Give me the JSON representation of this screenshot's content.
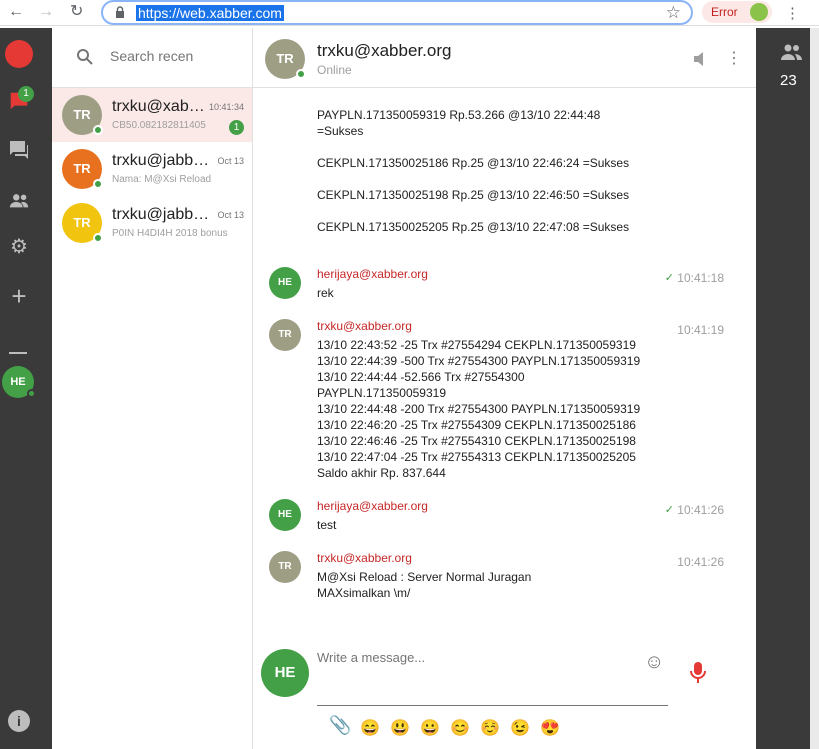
{
  "browser": {
    "url": "https://web.xabber.com",
    "error_label": "Error"
  },
  "rail": {
    "unread_badge": "1",
    "user_avatar": "HE"
  },
  "contacts": {
    "search_placeholder": "Search recen",
    "items": [
      {
        "initials": "TR",
        "name": "trxku@xabber.org",
        "time": "10:41:34",
        "preview": "CB50.082182811405",
        "count": "1",
        "color": "#9e9e85"
      },
      {
        "initials": "TR",
        "name": "trxku@jabbim.com",
        "time": "Oct 13",
        "preview": "Nama: M@Xsi Reload",
        "color": "#e8711f"
      },
      {
        "initials": "TR",
        "name": "trxku@jabber.cz",
        "time": "Oct 13",
        "preview": "P0IN H4DI4H 2018 bonus",
        "color": "#f1c40f"
      }
    ]
  },
  "chat": {
    "avatar": "TR",
    "title": "trxku@xabber.org",
    "status": "Online",
    "top_lines": [
      "PAYPLN.171350059319 Rp.53.266 @13/10 22:44:48",
      "=Sukses",
      "CEKPLN.171350025186 Rp.25 @13/10 22:46:24 =Sukses",
      "CEKPLN.171350025198 Rp.25 @13/10 22:46:50 =Sukses",
      "CEKPLN.171350025205 Rp.25 @13/10 22:47:08 =Sukses"
    ],
    "messages": [
      {
        "avatar": "HE",
        "sender": "herijaya@xabber.org",
        "time": "10:41:18",
        "check": "✓",
        "body": "rek"
      },
      {
        "avatar": "TR",
        "sender": "trxku@xabber.org",
        "time": "10:41:19",
        "body": "13/10 22:43:52 -25 Trx #27554294 CEKPLN.171350059319\n13/10 22:44:39 -500 Trx #27554300 PAYPLN.171350059319\n13/10 22:44:44 -52.566 Trx #27554300\nPAYPLN.171350059319\n13/10 22:44:48 -200 Trx #27554300 PAYPLN.171350059319\n13/10 22:46:20 -25 Trx #27554309 CEKPLN.171350025186\n13/10 22:46:46 -25 Trx #27554310 CEKPLN.171350025198\n13/10 22:47:04 -25 Trx #27554313 CEKPLN.171350025205\nSaldo akhir Rp. 837.644"
      },
      {
        "avatar": "HE",
        "sender": "herijaya@xabber.org",
        "time": "10:41:26",
        "check": "✓",
        "body": "test"
      },
      {
        "avatar": "TR",
        "sender": "trxku@xabber.org",
        "time": "10:41:26",
        "body": "M@Xsi Reload : Server Normal Juragan\nMAXsimalkan \\m/"
      }
    ],
    "composer_avatar": "HE",
    "composer_placeholder": "Write a message...",
    "emojis": [
      "😄",
      "😃",
      "😀",
      "😊",
      "☺️",
      "😉",
      "😍"
    ]
  },
  "right_panel": {
    "participants_count": "23"
  },
  "colors": {
    "accent_green": "#43a047",
    "sender_red": "#c62828",
    "rail_bg": "#3a3a3a",
    "active_contact_bg": "#fbe9e7"
  }
}
